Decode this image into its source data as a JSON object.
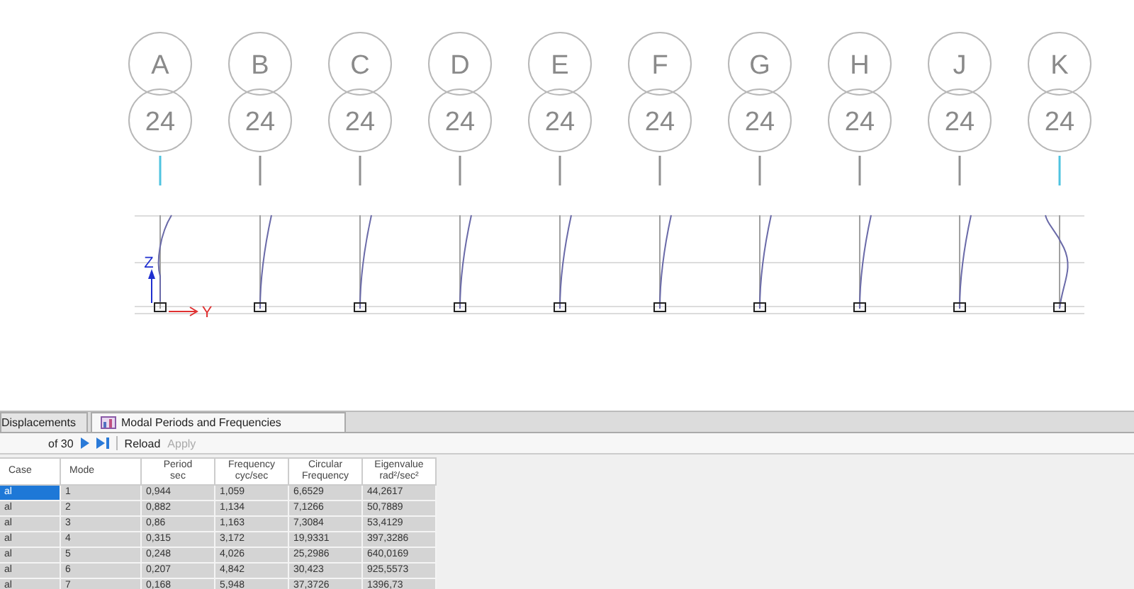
{
  "grid_bubbles": [
    {
      "label": "A",
      "story": "24",
      "highlighted": true
    },
    {
      "label": "B",
      "story": "24",
      "highlighted": false
    },
    {
      "label": "C",
      "story": "24",
      "highlighted": false
    },
    {
      "label": "D",
      "story": "24",
      "highlighted": false
    },
    {
      "label": "E",
      "story": "24",
      "highlighted": false
    },
    {
      "label": "F",
      "story": "24",
      "highlighted": false
    },
    {
      "label": "G",
      "story": "24",
      "highlighted": false
    },
    {
      "label": "H",
      "story": "24",
      "highlighted": false
    },
    {
      "label": "J",
      "story": "24",
      "highlighted": false
    },
    {
      "label": "K",
      "story": "24",
      "highlighted": true
    }
  ],
  "axes": {
    "z": "Z",
    "y": "Y"
  },
  "tabs": [
    {
      "label": "Displacements",
      "selected": false
    },
    {
      "label": "Modal Periods and Frequencies",
      "selected": true
    }
  ],
  "toolbar": {
    "page_of": "of 30",
    "reload": "Reload",
    "apply": "Apply",
    "apply_disabled": true
  },
  "table": {
    "columns": [
      "Case",
      "Mode",
      "Period\nsec",
      "Frequency\ncyc/sec",
      "Circular\nFrequency",
      "Eigenvalue\nrad²/sec²"
    ],
    "rows": [
      {
        "selected": true,
        "cells": [
          "al",
          "1",
          "0,944",
          "1,059",
          "6,6529",
          "44,2617"
        ]
      },
      {
        "selected": false,
        "cells": [
          "al",
          "2",
          "0,882",
          "1,134",
          "7,1266",
          "50,7889"
        ]
      },
      {
        "selected": false,
        "cells": [
          "al",
          "3",
          "0,86",
          "1,163",
          "7,3084",
          "53,4129"
        ]
      },
      {
        "selected": false,
        "cells": [
          "al",
          "4",
          "0,315",
          "3,172",
          "19,9331",
          "397,3286"
        ]
      },
      {
        "selected": false,
        "cells": [
          "al",
          "5",
          "0,248",
          "4,026",
          "25,2986",
          "640,0169"
        ]
      },
      {
        "selected": false,
        "cells": [
          "al",
          "6",
          "0,207",
          "4,842",
          "30,423",
          "925,5573"
        ]
      },
      {
        "selected": false,
        "cells": [
          "al",
          "7",
          "0,168",
          "5,948",
          "37,3726",
          "1396,73"
        ]
      }
    ]
  }
}
